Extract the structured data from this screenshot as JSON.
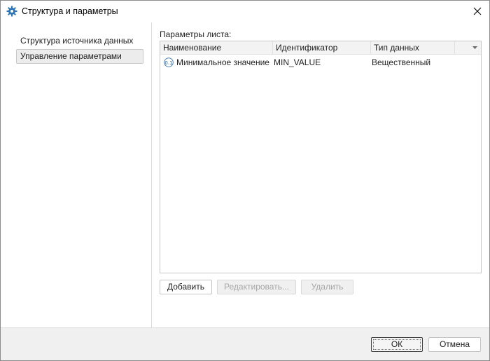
{
  "window": {
    "title": "Структура и параметры",
    "icon": "gear-icon"
  },
  "sidebar": {
    "items": [
      {
        "label": "Структура источника данных",
        "selected": false
      },
      {
        "label": "Управление параметрами",
        "selected": true
      }
    ]
  },
  "main": {
    "section_label": "Параметры листа:",
    "table": {
      "columns": [
        "Наименование",
        "Идентификатор",
        "Тип данных"
      ],
      "rows": [
        {
          "icon": "numeric-parameter-icon",
          "name": "Минимальное значение",
          "id": "MIN_VALUE",
          "type": "Вещественный"
        }
      ]
    },
    "actions": {
      "add_label": "Добавить",
      "edit_label": "Редактировать...",
      "delete_label": "Удалить"
    }
  },
  "footer": {
    "ok_label": "ОК",
    "cancel_label": "Отмена"
  },
  "colors": {
    "accent": "#2e75b6",
    "footer_bg": "#f0f0f0",
    "disabled_text": "#a6a6a6"
  }
}
